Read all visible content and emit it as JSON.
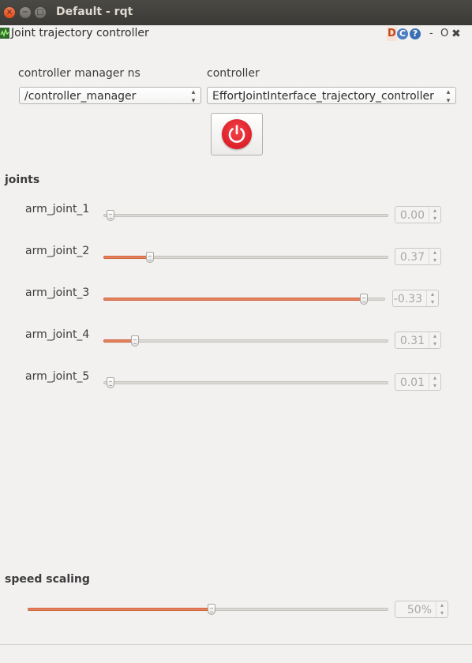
{
  "window": {
    "title": "Default - rqt",
    "close_glyph": "×",
    "minimize_glyph": "−",
    "maximize_glyph": "□"
  },
  "plugin": {
    "title": "Joint trajectory controller",
    "icon": "plot-icon",
    "header_icons": {
      "d": "D",
      "reload": "C",
      "help": "?",
      "minimize": "-",
      "float": "O",
      "close": "✖"
    }
  },
  "controller_manager": {
    "label": "controller manager ns",
    "value": "/controller_manager"
  },
  "controller": {
    "label": "controller",
    "value": "EffortJointInterface_trajectory_controller"
  },
  "power_button": {
    "icon": "power-icon",
    "state": "off"
  },
  "joints": {
    "title": "joints",
    "items": [
      {
        "name": "arm_joint_1",
        "value": "0.00",
        "fraction": 0.0
      },
      {
        "name": "arm_joint_2",
        "value": "0.37",
        "fraction": 0.145
      },
      {
        "name": "arm_joint_3",
        "value": "-0.33",
        "fraction": 0.925
      },
      {
        "name": "arm_joint_4",
        "value": "0.31",
        "fraction": 0.09
      },
      {
        "name": "arm_joint_5",
        "value": "0.01",
        "fraction": 0.0
      }
    ]
  },
  "speed_scaling": {
    "title": "speed scaling",
    "value": "50%",
    "fraction": 0.5
  },
  "colors": {
    "slider_fill": "#e5835f",
    "power_red": "#e21e26",
    "titlebar": "#3c3b37"
  }
}
